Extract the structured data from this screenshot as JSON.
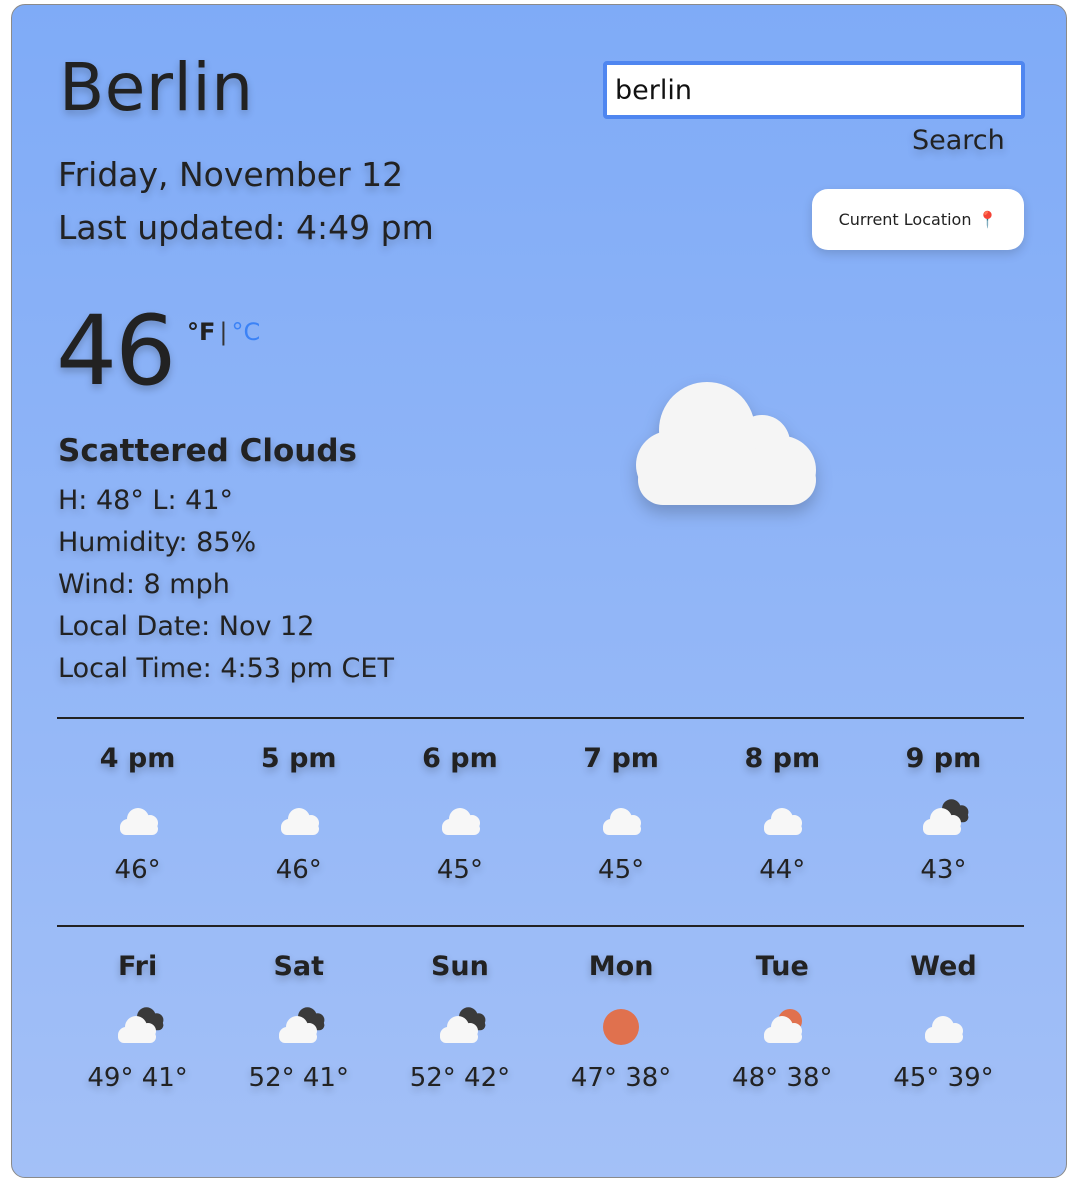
{
  "city": "Berlin",
  "date": "Friday, November 12",
  "last_updated": "Last updated: 4:49 pm",
  "search": {
    "value": "berlin",
    "button_label": "Search"
  },
  "location_button": {
    "label": "Current Location"
  },
  "current": {
    "temp": "46",
    "unit_f": "°F",
    "unit_sep": "|",
    "unit_c": "°C",
    "description": "Scattered Clouds",
    "hi_lo": "H: 48° L: 41°",
    "humidity": "Humidity: 85%",
    "wind": "Wind: 8 mph",
    "local_date": "Local Date: Nov 12",
    "local_time": "Local Time: 4:53 pm CET",
    "icon": "cloud-icon"
  },
  "hourly": [
    {
      "label": "4 pm",
      "icon": "cloud-icon",
      "temp": "46°"
    },
    {
      "label": "5 pm",
      "icon": "cloud-icon",
      "temp": "46°"
    },
    {
      "label": "6 pm",
      "icon": "cloud-icon",
      "temp": "45°"
    },
    {
      "label": "7 pm",
      "icon": "cloud-icon",
      "temp": "45°"
    },
    {
      "label": "8 pm",
      "icon": "cloud-icon",
      "temp": "44°"
    },
    {
      "label": "9 pm",
      "icon": "broken-clouds-icon",
      "temp": "43°"
    }
  ],
  "daily": [
    {
      "label": "Fri",
      "icon": "broken-clouds-icon",
      "temps": "49° 41°"
    },
    {
      "label": "Sat",
      "icon": "broken-clouds-icon",
      "temps": "52° 41°"
    },
    {
      "label": "Sun",
      "icon": "broken-clouds-icon",
      "temps": "52° 42°"
    },
    {
      "label": "Mon",
      "icon": "sun-icon",
      "temps": "47° 38°"
    },
    {
      "label": "Tue",
      "icon": "partly-cloudy-icon",
      "temps": "48° 38°"
    },
    {
      "label": "Wed",
      "icon": "cloud-icon",
      "temps": "45° 39°"
    }
  ],
  "colors": {
    "background_top": "#7fabf7",
    "background_bottom": "#a3c0f7",
    "celsius_link": "#3b82f6",
    "sun": "#e0714e",
    "input_border": "#4f86f0"
  }
}
